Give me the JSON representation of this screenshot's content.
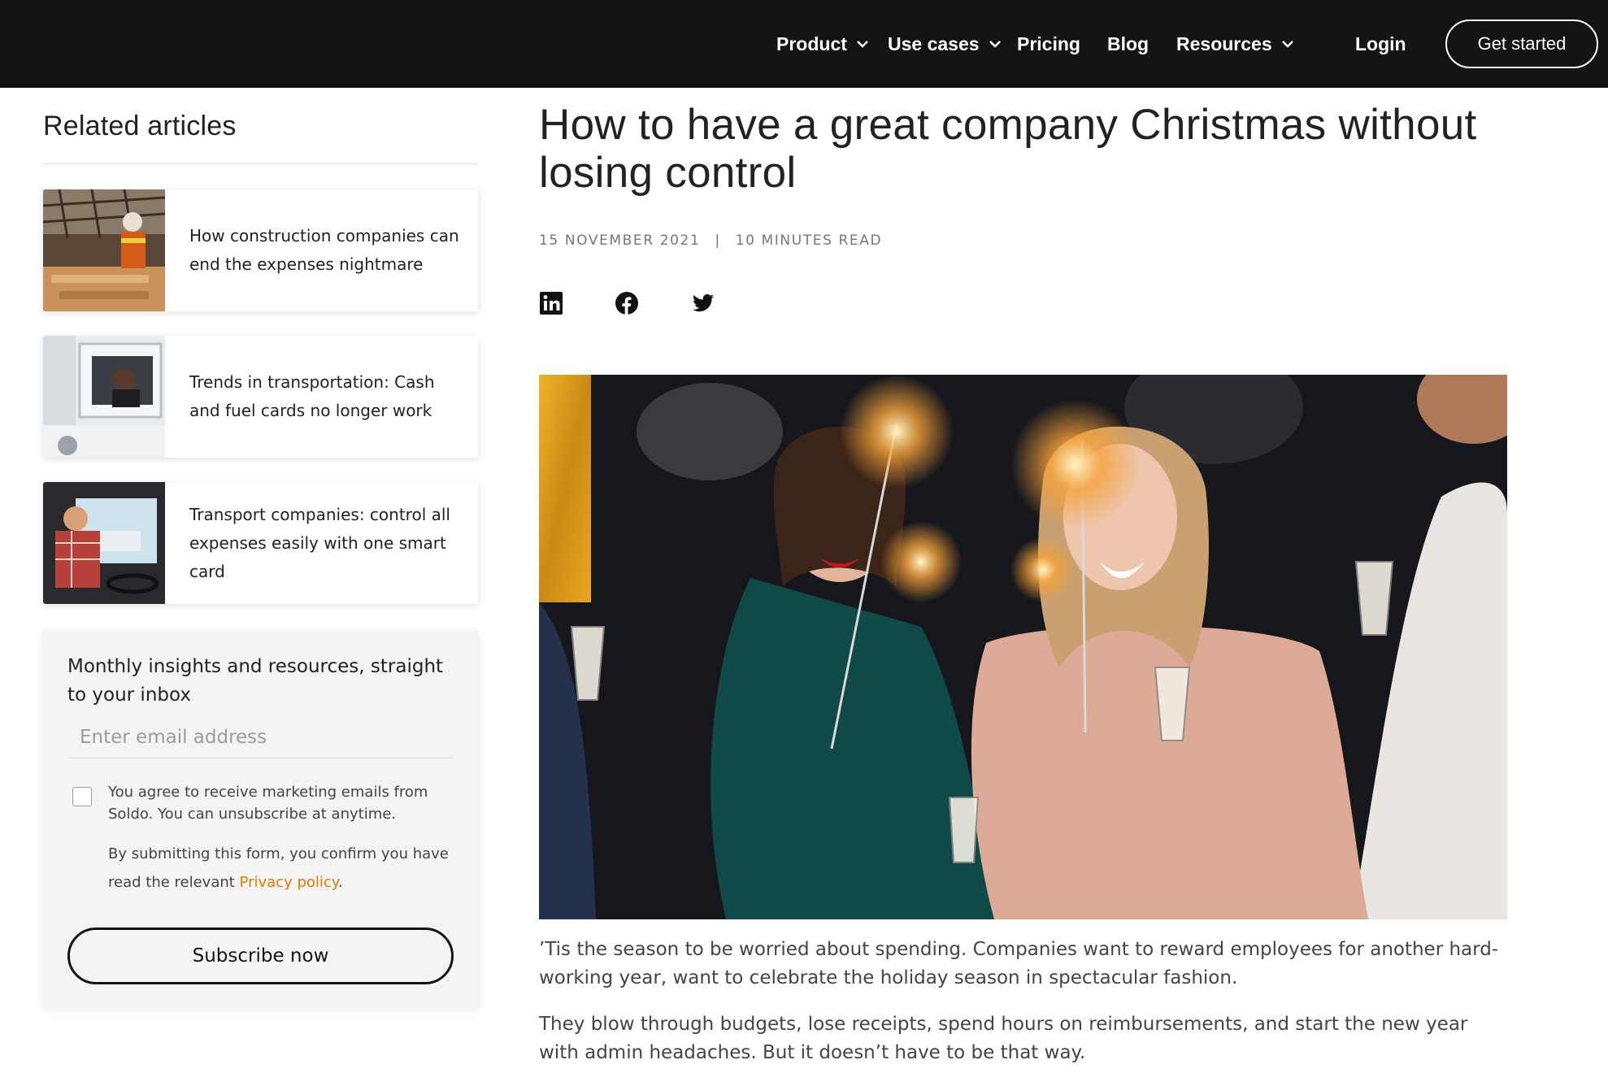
{
  "nav": {
    "items": [
      {
        "label": "Product",
        "has_dropdown": true
      },
      {
        "label": "Use cases",
        "has_dropdown": true
      },
      {
        "label": "Pricing",
        "has_dropdown": false
      },
      {
        "label": "Blog",
        "has_dropdown": false
      },
      {
        "label": "Resources",
        "has_dropdown": true
      }
    ],
    "login": "Login",
    "cta": "Get started"
  },
  "sidebar": {
    "title": "Related articles",
    "articles": [
      {
        "title": "How construction companies can end the expenses nightmare",
        "thumb": "construction-worker-photo"
      },
      {
        "title": "Trends in transportation: Cash and fuel cards no longer work",
        "thumb": "truck-driver-photo"
      },
      {
        "title": "Transport companies: control all expenses easily with one smart card",
        "thumb": "truck-cab-driver-photo"
      }
    ],
    "newsletter": {
      "heading": "Monthly insights and resources, straight to your inbox",
      "email_placeholder": "Enter email address",
      "email_value": "",
      "consent": "You agree to receive marketing emails from Soldo. You can unsubscribe at anytime.",
      "confirm_prefix": "By submitting this form, you confirm you have read the relevant ",
      "privacy_link": "Privacy policy",
      "confirm_suffix": ".",
      "button": "Subscribe now"
    }
  },
  "article": {
    "title": "How to have a great company Christmas without losing control",
    "date": "15 NOVEMBER 2021",
    "separator": "|",
    "read_time": "10 MINUTES READ",
    "share": [
      "linkedin-icon",
      "facebook-icon",
      "twitter-icon"
    ],
    "hero_image": "office-party-sparklers-photo",
    "paragraphs": [
      "’Tis the season to be worried about spending. Companies want to reward employees for another hard-working year, want to celebrate the holiday season in spectacular fashion.",
      "They blow through budgets, lose receipts, spend hours on reimbursements, and start the new year with admin headaches. But it doesn’t have to be that way."
    ]
  },
  "colors": {
    "nav_bg": "#141414",
    "accent_link": "#e07b00",
    "newsletter_bg": "#f4f4f4"
  }
}
